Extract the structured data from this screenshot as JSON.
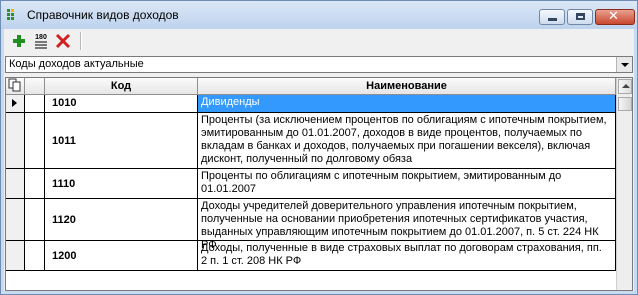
{
  "window": {
    "title": "Справочник видов доходов"
  },
  "toolbar": {
    "add_icon": "plus-icon",
    "rotate_label": "180",
    "delete_icon": "x-icon"
  },
  "filter": {
    "selected": "Коды доходов актуальные"
  },
  "table": {
    "columns": [
      "Код",
      "Наименование"
    ],
    "rows": [
      {
        "code": "1010",
        "name": "Дивиденды",
        "selected": true
      },
      {
        "code": "1011",
        "name": "Проценты (за исключением процентов по облигациям с ипотечным покрытием, эмитированным до 01.01.2007, доходов в виде процентов, получаемых по вкладам в банках и доходов, получаемых при погашении векселя), включая дисконт, полученный по долговому обяза"
      },
      {
        "code": "1110",
        "name": "Проценты по облигациям с ипотечным покрытием, эмитированным до 01.01.2007"
      },
      {
        "code": "1120",
        "name": "Доходы учредителей доверительного управления ипотечным покрытием, полученные на основании приобретения ипотечных сертификатов участия, выданных управляющим ипотечным покрытием до 01.01.2007, п. 5 ст. 224 НК РФ"
      },
      {
        "code": "1200",
        "name": "Доходы, полученные в виде страховых выплат по договорам страхования, пп. 2 п. 1 ст. 208 НК РФ"
      }
    ]
  }
}
